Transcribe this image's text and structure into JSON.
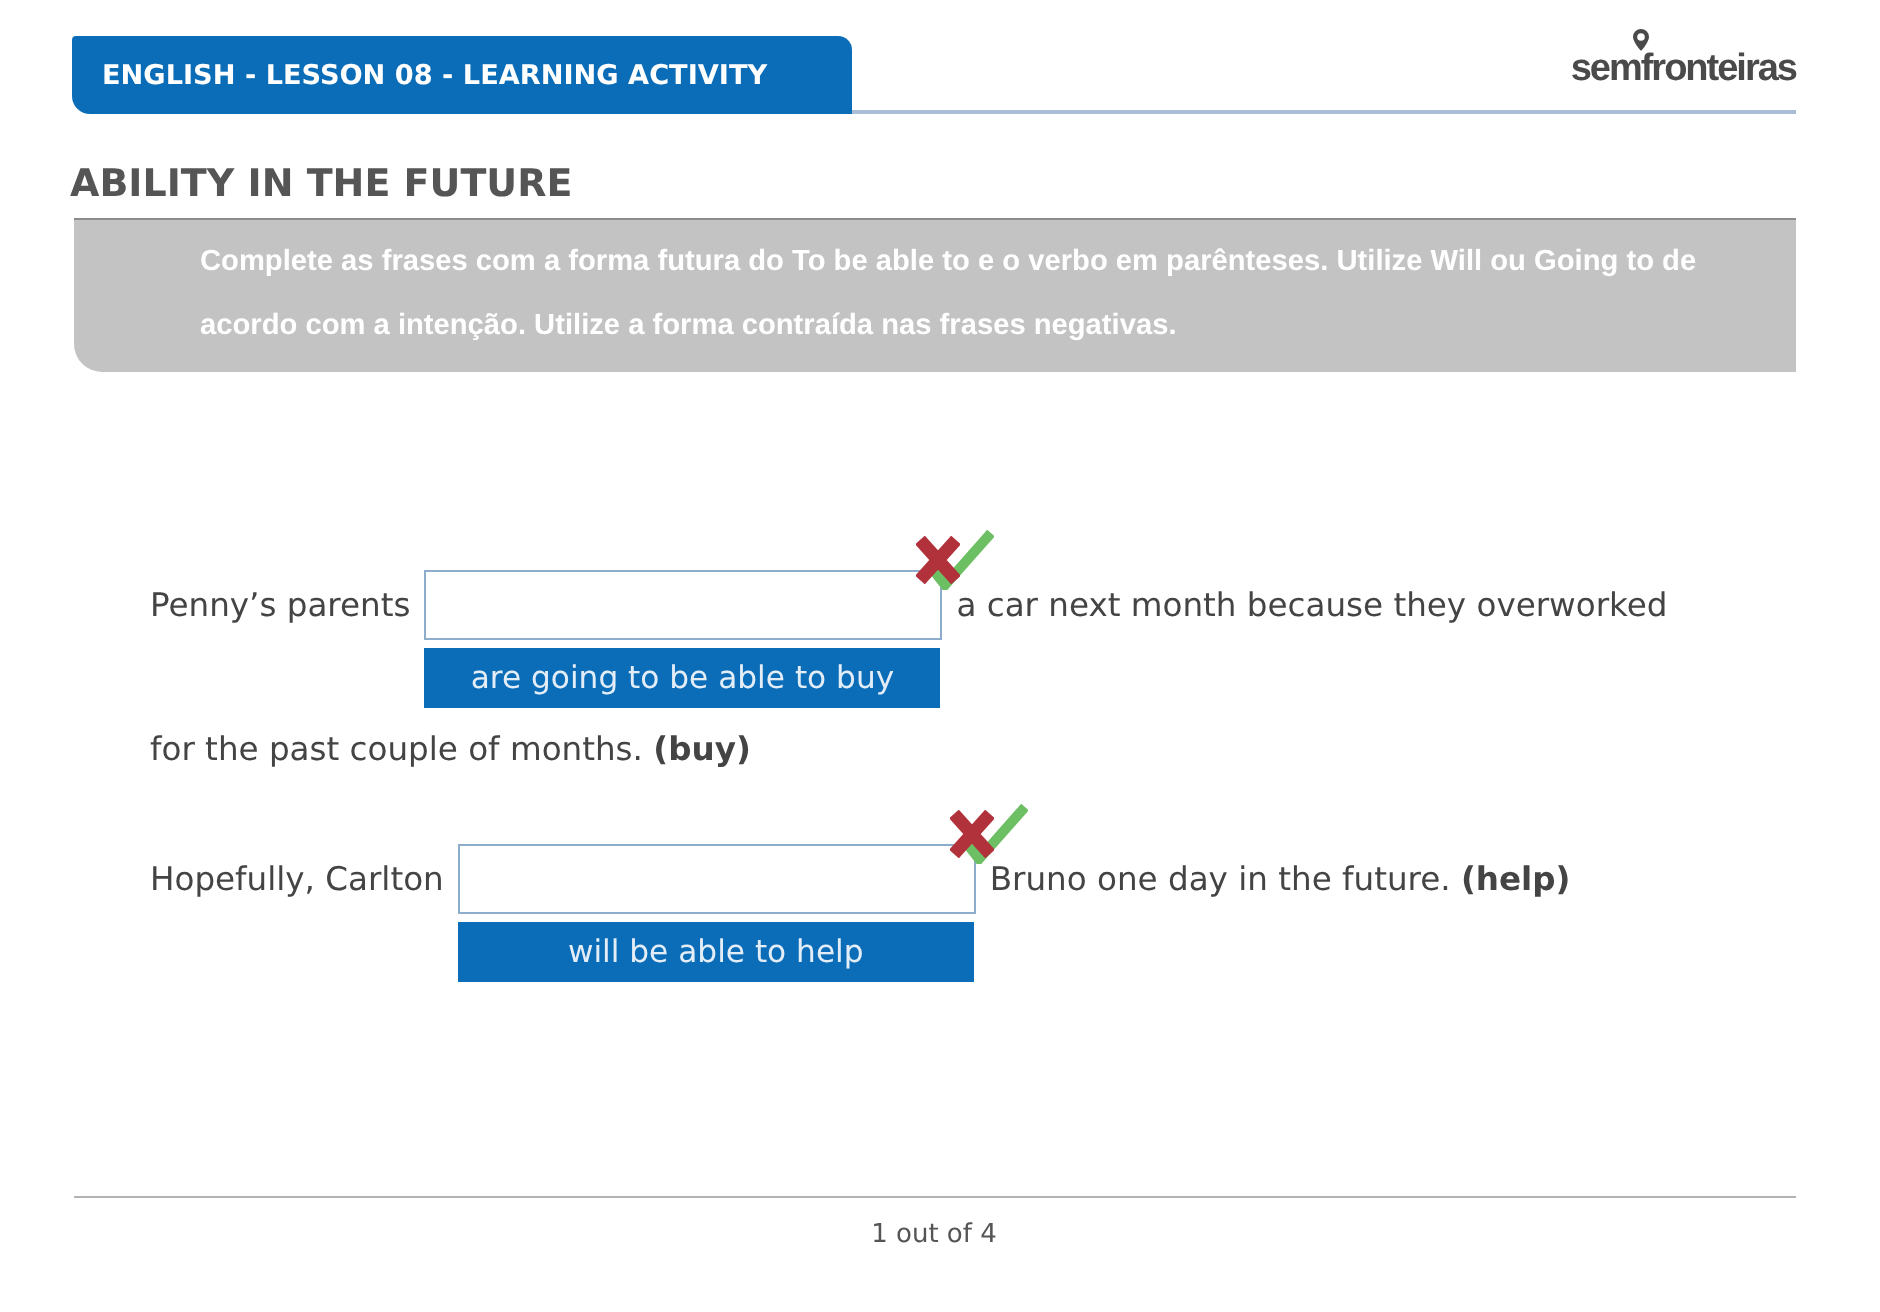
{
  "header": {
    "title": "ENGLISH - LESSON 08 - LEARNING ACTIVITY",
    "logo": "semfronteiras"
  },
  "section": {
    "title": "ABILITY IN THE FUTURE",
    "instructions": "Complete as frases com a forma futura do To be able to e o verbo em parênteses. Utilize Will ou Going to de acordo com a intenção. Utilize a forma contraída nas frases negativas."
  },
  "exercises": [
    {
      "lines": [
        [
          {
            "kind": "text",
            "text": "Penny’s parents"
          },
          {
            "kind": "blank",
            "answer": "are going to be able to buy"
          },
          {
            "kind": "text",
            "text": "a car next month because they overworked"
          }
        ],
        [
          {
            "kind": "text",
            "text": "for the past couple of months. **(buy)**"
          }
        ]
      ]
    },
    {
      "lines": [
        [
          {
            "kind": "text",
            "text": "Hopefully, Carlton"
          },
          {
            "kind": "blank",
            "answer": "will be able to help"
          },
          {
            "kind": "text",
            "text": "Bruno one day in the future. **(help)**"
          }
        ]
      ]
    }
  ],
  "footer": {
    "page": "1 out of 4"
  }
}
